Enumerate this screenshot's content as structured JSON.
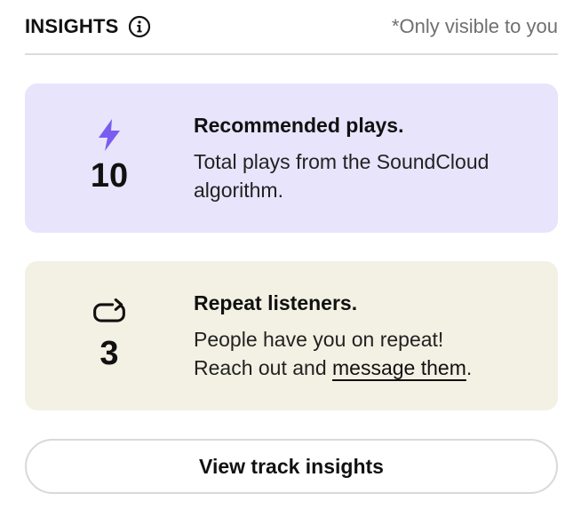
{
  "header": {
    "title": "INSIGHTS",
    "info_icon": "info-icon",
    "visibility_note": "*Only visible to you"
  },
  "cards": [
    {
      "icon": "lightning-bolt-icon",
      "icon_color": "#7a5cf0",
      "value": "10",
      "title": "Recommended plays.",
      "description": "Total plays from the SoundCloud algorithm.",
      "background": "#e7e4fb"
    },
    {
      "icon": "repeat-icon",
      "icon_color": "#111111",
      "value": "3",
      "title": "Repeat listeners.",
      "description_line1": "People have you on repeat!",
      "description_prefix": "Reach out and ",
      "description_link": "message them",
      "description_suffix": ".",
      "background": "#f3f1e4"
    }
  ],
  "button": {
    "label": "View track insights"
  }
}
